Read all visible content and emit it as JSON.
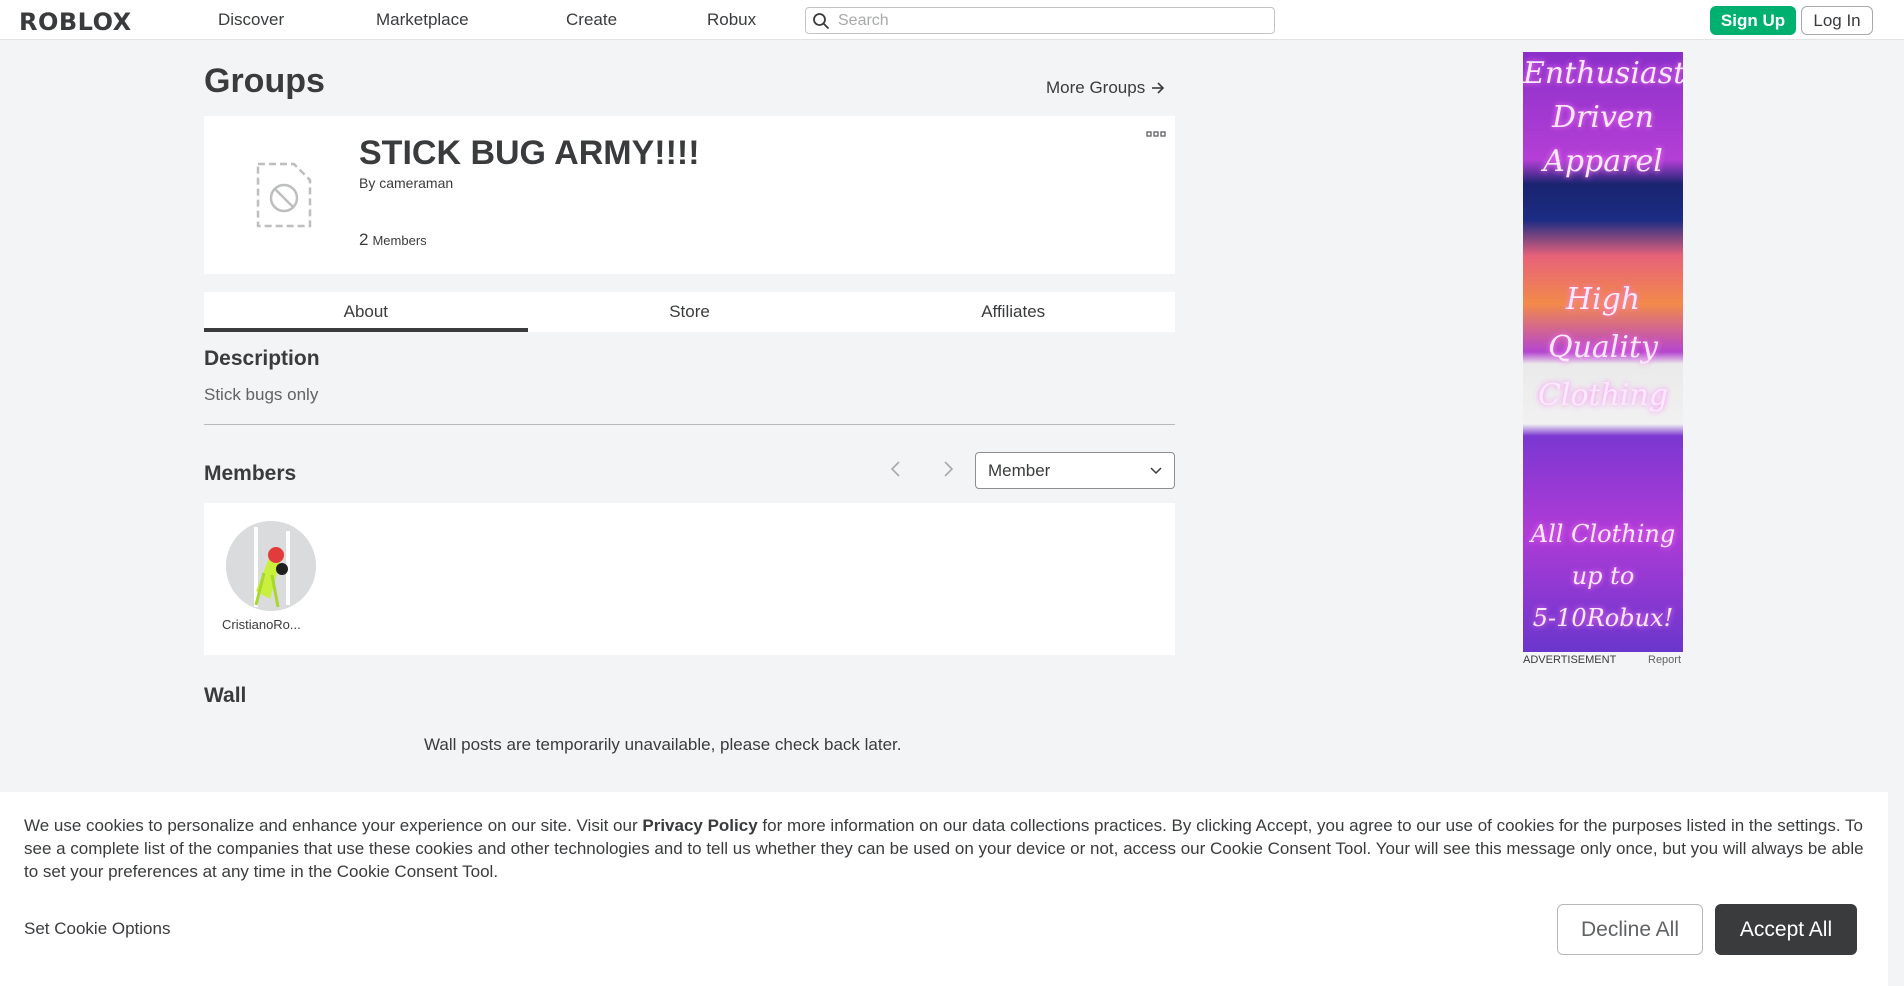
{
  "nav": {
    "logo": "ROBLOX",
    "links": [
      "Discover",
      "Marketplace",
      "Create",
      "Robux"
    ],
    "search_placeholder": "Search",
    "signup": "Sign Up",
    "login": "Log In"
  },
  "page": {
    "title": "Groups",
    "more_groups": "More Groups"
  },
  "group": {
    "name": "STICK BUG ARMY!!!!",
    "by_prefix": "By",
    "owner": "cameraman",
    "member_count": "2",
    "member_label": "Members"
  },
  "tabs": [
    "About",
    "Store",
    "Affiliates"
  ],
  "about": {
    "description_title": "Description",
    "description": "Stick bugs only",
    "members_title": "Members",
    "role_filter": "Member",
    "members": [
      {
        "name": "CristianoRo..."
      }
    ],
    "wall_title": "Wall",
    "wall_message": "Wall posts are temporarily unavailable, please check back later."
  },
  "ad": {
    "lines": [
      "Enthusiast",
      "Driven",
      "Apparel",
      "High",
      "Quality",
      "Clothing",
      "All Clothing",
      "up to",
      "5-10Robux!"
    ],
    "label": "ADVERTISEMENT",
    "report": "Report"
  },
  "cookie": {
    "text_before": "We use cookies to personalize and enhance your experience on our site. Visit our ",
    "policy_link": "Privacy Policy",
    "text_after": " for more information on our data collections practices. By clicking Accept, you agree to our use of cookies for the purposes listed in the settings. To see a complete list of the companies that use these cookies and other technologies and to tell us whether they can be used on your device or not, access our Cookie Consent Tool. Your will see this message only once, but you will always be able to set your preferences at any time in the Cookie Consent Tool.",
    "set_options": "Set Cookie Options",
    "decline": "Decline All",
    "accept": "Accept All"
  },
  "colors": {
    "signup_green": "#00b06f",
    "text_dark": "#393b3d",
    "page_bg": "#f2f4f5"
  }
}
